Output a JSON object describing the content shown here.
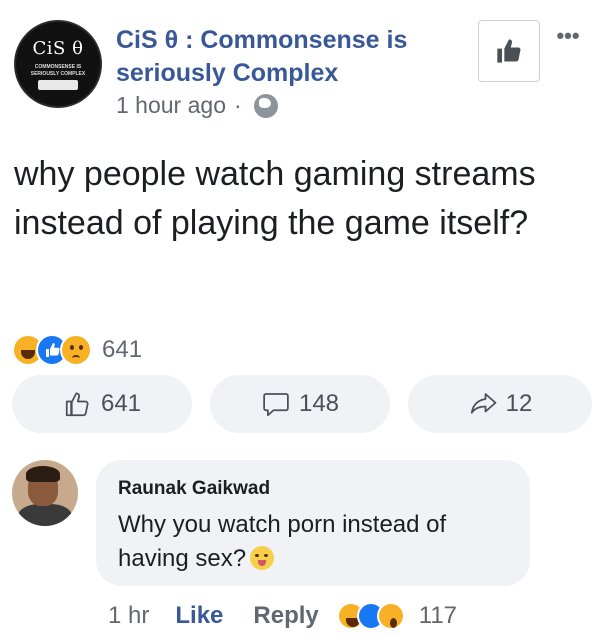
{
  "post": {
    "page_logo_text": "CiS θ",
    "page_logo_subtext": "COMMONSENSE IS SERIOUSLY COMPLEX",
    "page_name": "CiS θ : Commonsense is seriously Complex",
    "time": "1 hour ago",
    "separator": "·",
    "privacy_icon": "globe-icon",
    "text": "why people watch gaming streams instead of playing the game itself?",
    "reactions": [
      "haha",
      "like",
      "sad"
    ],
    "reaction_count": "641"
  },
  "actions": {
    "like_count": "641",
    "comment_count": "148",
    "share_count": "12"
  },
  "comment": {
    "author": "Raunak Gaikwad",
    "text": "Why you watch porn instead of having sex?",
    "time": "1 hr",
    "like_label": "Like",
    "reply_label": "Reply",
    "reactions": [
      "haha",
      "like",
      "wow"
    ],
    "reaction_count": "117"
  },
  "colors": {
    "link_blue": "#385898",
    "like_blue": "#1877f2",
    "pill_bg": "#f0f2f5",
    "muted_text": "#606770"
  }
}
